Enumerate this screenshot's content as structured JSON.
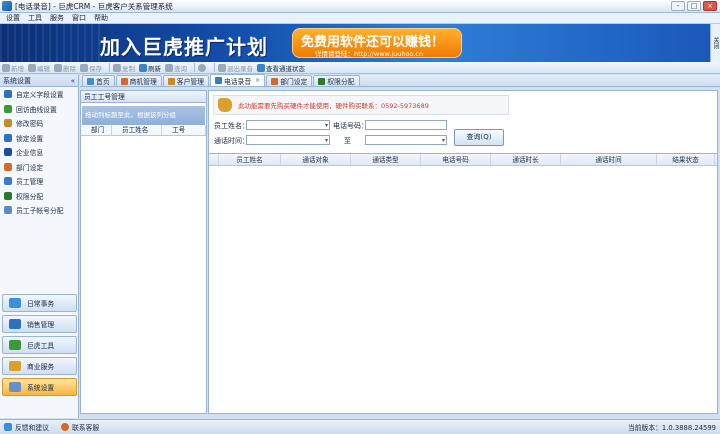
{
  "window": {
    "title": "[电话录音] - 巨虎CRM - 巨虎客户关系管理系统",
    "controls": [
      "-",
      "□",
      "×"
    ]
  },
  "menu": [
    "设置",
    "工具",
    "服务",
    "窗口",
    "帮助"
  ],
  "banner": {
    "headline": "加入巨虎推广计划",
    "promo_title": "免费用软件还可以赚钱！",
    "promo_sub": "详情请登陆：http://www.juuhoo.cn",
    "side_tab": "关闭"
  },
  "toolbar": {
    "items": [
      {
        "label": "新增",
        "enabled": false
      },
      {
        "label": "编辑",
        "enabled": false
      },
      {
        "label": "删除",
        "enabled": false
      },
      {
        "label": "保存",
        "enabled": false
      },
      {
        "label": "复制",
        "enabled": false
      },
      {
        "label": "刷新",
        "enabled": true
      },
      {
        "label": "查询",
        "enabled": false
      },
      {
        "label": "",
        "enabled": false
      },
      {
        "label": "退出录音",
        "enabled": false
      },
      {
        "label": "查看通道状态",
        "enabled": true
      }
    ]
  },
  "left_panel": {
    "header": "系统设置",
    "collapse_icon": "«",
    "items": [
      {
        "label": "自定义字段设置",
        "color": "#2f6fc0"
      },
      {
        "label": "回访曲线设置",
        "color": "#3a9a3a"
      },
      {
        "label": "修改密码",
        "color": "#c98a2a"
      },
      {
        "label": "锁定设置",
        "color": "#2f6fc0"
      },
      {
        "label": "企业信息",
        "color": "#1d4f9a"
      },
      {
        "label": "部门设定",
        "color": "#d46a2a"
      },
      {
        "label": "员工管理",
        "color": "#3a7ac8"
      },
      {
        "label": "权限分配",
        "color": "#2a7a2a"
      },
      {
        "label": "员工子帐号分配",
        "color": "#5a8ac8"
      }
    ],
    "nav": [
      {
        "label": "日常事务",
        "active": false,
        "color": "#3a8fd8"
      },
      {
        "label": "销售管理",
        "active": false,
        "color": "#2f6fc0"
      },
      {
        "label": "巨虎工具",
        "active": false,
        "color": "#3a9a3a"
      },
      {
        "label": "商业服务",
        "active": false,
        "color": "#d9a02c"
      },
      {
        "label": "系统设置",
        "active": true,
        "color": "#6a8fc8"
      }
    ]
  },
  "tabs": [
    {
      "label": "首页",
      "active": false,
      "closable": false,
      "color": "#3a8fd8"
    },
    {
      "label": "商机管理",
      "active": false,
      "closable": false,
      "color": "#d46a2a"
    },
    {
      "label": "客户管理",
      "active": false,
      "closable": false,
      "color": "#c98a2a"
    },
    {
      "label": "电话录音",
      "active": true,
      "closable": true,
      "color": "#3a7ac8"
    },
    {
      "label": "部门设定",
      "active": false,
      "closable": false,
      "color": "#d46a2a"
    },
    {
      "label": "权限分配",
      "active": false,
      "closable": false,
      "color": "#2a7a2a"
    }
  ],
  "sub_panel": {
    "header": "员工工号管理",
    "hint": "拖动列标题至此，根据该列分组",
    "columns": [
      "部门",
      "员工姓名",
      "工号"
    ]
  },
  "main": {
    "notice": "此功能需要先购买硬件才能使用，硬件购买联系：0592-5973689",
    "filters": {
      "employee_label": "员工姓名：",
      "employee_value": "",
      "phone_label": "电话号码：",
      "phone_value": "",
      "time_label": "通话时间：",
      "time_from": "",
      "to_label": "至",
      "time_to": ""
    },
    "query_button": "查询(Q)",
    "grid_columns": [
      "员工姓名",
      "通话对象",
      "通话类型",
      "电话号码",
      "通话时长",
      "通话时间",
      "结果状态"
    ]
  },
  "status": {
    "feedback": "反馈和建议",
    "support": "联系客服",
    "version": "当前版本：1.0.3888.24599"
  }
}
